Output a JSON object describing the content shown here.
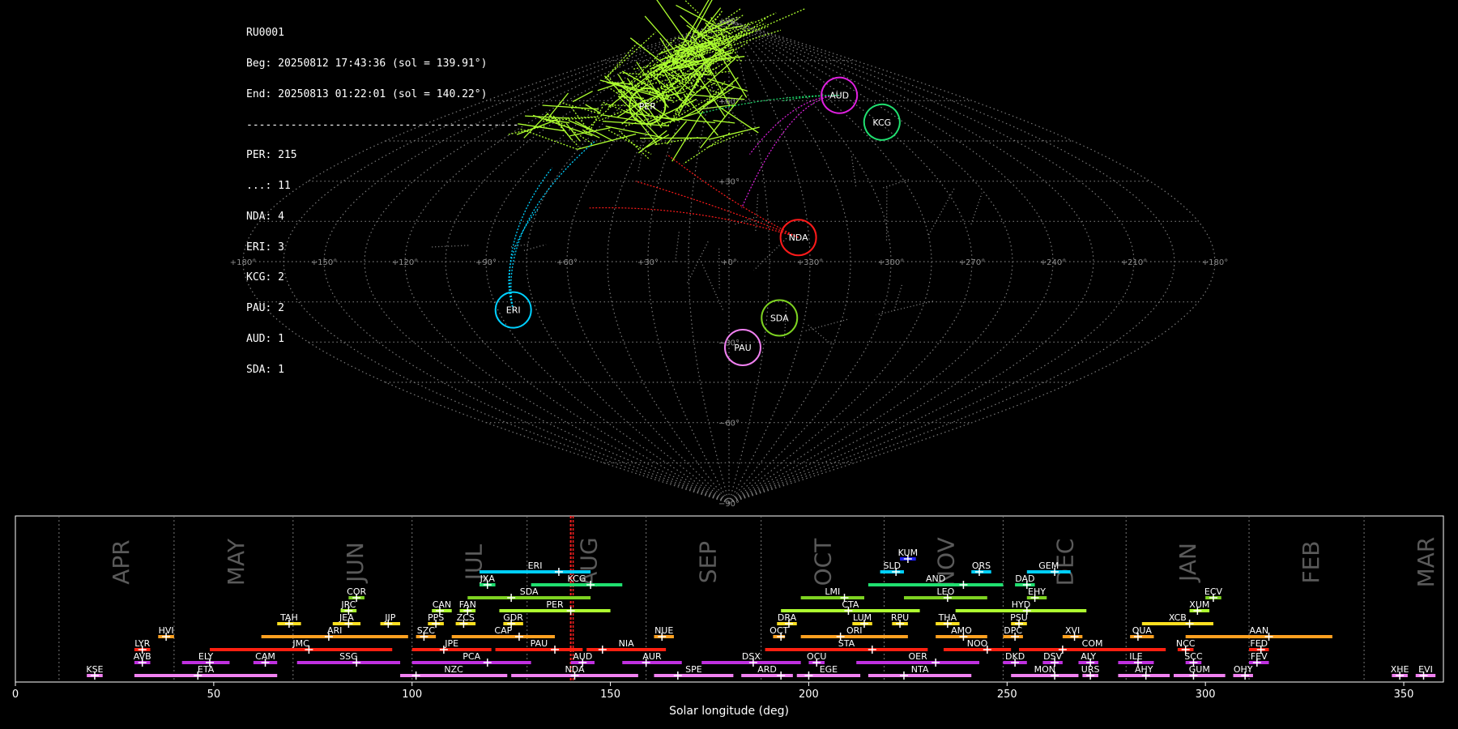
{
  "info": {
    "station": "RU0001",
    "beg": "Beg: 20250812 17:43:36 (sol = 139.91°)",
    "end": "End: 20250813 01:22:01 (sol = 140.22°)",
    "divider": "-------------------------------------------",
    "counts": [
      "PER: 215",
      "...: 11",
      "NDA: 4",
      "ERI: 3",
      "KCG: 2",
      "PAU: 2",
      "AUD: 1",
      "SDA: 1"
    ]
  },
  "colors": {
    "background": "#000000",
    "grid": "#7a7a7a",
    "PER": "#adff2f",
    "ERI": "#00d0ff",
    "NDA": "#ff1a1a",
    "KCG": "#20e070",
    "AUD": "#e020e0",
    "SDA": "#7ed321",
    "PAU": "#f080f0",
    "sporadic": "#8a8a8a"
  },
  "chart_data": [
    {
      "type": "scatter",
      "projection": "sinusoidal",
      "lon_labels": [
        "+180°",
        "+150°",
        "+120°",
        "+90°",
        "+60°",
        "+30°",
        "+0°",
        "+330°",
        "+300°",
        "+270°",
        "+240°",
        "+210°",
        "+180°"
      ],
      "lon_values": [
        180,
        150,
        120,
        90,
        60,
        30,
        0,
        330,
        300,
        270,
        240,
        210,
        180
      ],
      "lat_labels": [
        "+90°",
        "+60°",
        "+30°",
        "+0°",
        "−30°",
        "−60°",
        "−90°"
      ],
      "lat_values": [
        90,
        60,
        30,
        0,
        -30,
        -60,
        -90
      ],
      "grid": true,
      "radiants": [
        {
          "name": "PER",
          "lon": 57,
          "lat": 58,
          "circle_r": 4
        },
        {
          "name": "AUD",
          "lon": -87,
          "lat": 62,
          "circle_r": 4.5
        },
        {
          "name": "KCG",
          "lon": -92,
          "lat": 52,
          "circle_r": 4.5
        },
        {
          "name": "NDA",
          "lon": -26,
          "lat": 9,
          "circle_r": 3
        },
        {
          "name": "SDA",
          "lon": -20,
          "lat": -21,
          "circle_r": 3
        },
        {
          "name": "PAU",
          "lon": -6,
          "lat": -32,
          "circle_r": 3
        },
        {
          "name": "ERI",
          "lon": 84,
          "lat": -18,
          "circle_r": 3
        }
      ]
    },
    {
      "type": "bar",
      "orientation": "horizontal-ranges",
      "xlabel": "Solar longitude (deg)",
      "xlim": [
        0,
        360
      ],
      "xticks": [
        0,
        50,
        100,
        150,
        200,
        250,
        300,
        350
      ],
      "current_sol": 140,
      "months": [
        {
          "label": "APR",
          "start": 11
        },
        {
          "label": "MAY",
          "start": 40
        },
        {
          "label": "JUN",
          "start": 70
        },
        {
          "label": "JUL",
          "start": 100
        },
        {
          "label": "AUG",
          "start": 129
        },
        {
          "label": "SEP",
          "start": 159
        },
        {
          "label": "OCT",
          "start": 188
        },
        {
          "label": "NOV",
          "start": 219
        },
        {
          "label": "DEC",
          "start": 249
        },
        {
          "label": "JAN",
          "start": 280
        },
        {
          "label": "FEB",
          "start": 311
        },
        {
          "label": "MAR",
          "start": 340
        }
      ],
      "showers": [
        {
          "name": "KUM",
          "start": 223,
          "end": 227,
          "peak": 225,
          "row": 9,
          "color": "#2020ff"
        },
        {
          "name": "ERI",
          "start": 117,
          "end": 145,
          "peak": 137,
          "row": 8,
          "color": "#00d0ff"
        },
        {
          "name": "SLD",
          "start": 218,
          "end": 224,
          "peak": 222,
          "row": 8,
          "color": "#00d0ff"
        },
        {
          "name": "ORS",
          "start": 241,
          "end": 246,
          "peak": 243,
          "row": 8,
          "color": "#00d0ff"
        },
        {
          "name": "GEM",
          "start": 255,
          "end": 266,
          "peak": 262,
          "row": 8,
          "color": "#00d0ff"
        },
        {
          "name": "JXA",
          "start": 117,
          "end": 121,
          "peak": 119,
          "row": 7,
          "color": "#20e070"
        },
        {
          "name": "KCG",
          "start": 130,
          "end": 153,
          "peak": 145,
          "row": 7,
          "color": "#20e070"
        },
        {
          "name": "AND",
          "start": 215,
          "end": 249,
          "peak": 239,
          "row": 7,
          "color": "#20e070"
        },
        {
          "name": "DAD",
          "start": 252,
          "end": 257,
          "peak": 255,
          "row": 7,
          "color": "#20e070"
        },
        {
          "name": "COR",
          "start": 84,
          "end": 88,
          "peak": 86,
          "row": 6,
          "color": "#7ed321"
        },
        {
          "name": "SDA",
          "start": 114,
          "end": 145,
          "peak": 125,
          "row": 6,
          "color": "#7ed321"
        },
        {
          "name": "LMI",
          "start": 198,
          "end": 214,
          "peak": 209,
          "row": 6,
          "color": "#7ed321"
        },
        {
          "name": "LEO",
          "start": 224,
          "end": 245,
          "peak": 235,
          "row": 6,
          "color": "#7ed321"
        },
        {
          "name": "EHY",
          "start": 255,
          "end": 260,
          "peak": 257,
          "row": 6,
          "color": "#7ed321"
        },
        {
          "name": "ECV",
          "start": 300,
          "end": 304,
          "peak": 302,
          "row": 6,
          "color": "#7ed321"
        },
        {
          "name": "JRC",
          "start": 82,
          "end": 86,
          "peak": 84,
          "row": 5,
          "color": "#adff2f"
        },
        {
          "name": "CAN",
          "start": 105,
          "end": 110,
          "peak": 107,
          "row": 5,
          "color": "#adff2f"
        },
        {
          "name": "FAN",
          "start": 112,
          "end": 116,
          "peak": 114,
          "row": 5,
          "color": "#adff2f"
        },
        {
          "name": "PER",
          "start": 122,
          "end": 150,
          "peak": 140,
          "row": 5,
          "color": "#adff2f"
        },
        {
          "name": "CTA",
          "start": 193,
          "end": 228,
          "peak": 210,
          "row": 5,
          "color": "#adff2f"
        },
        {
          "name": "HYD",
          "start": 237,
          "end": 270,
          "peak": 255,
          "row": 5,
          "color": "#adff2f"
        },
        {
          "name": "XUM",
          "start": 296,
          "end": 301,
          "peak": 298,
          "row": 5,
          "color": "#adff2f"
        },
        {
          "name": "TAH",
          "start": 66,
          "end": 72,
          "peak": 69,
          "row": 4,
          "color": "#ffe020"
        },
        {
          "name": "JEA",
          "start": 80,
          "end": 87,
          "peak": 84,
          "row": 4,
          "color": "#ffe020"
        },
        {
          "name": "JIP",
          "start": 92,
          "end": 97,
          "peak": 94,
          "row": 4,
          "color": "#ffe020"
        },
        {
          "name": "PPS",
          "start": 104,
          "end": 108,
          "peak": 106,
          "row": 4,
          "color": "#ffe020"
        },
        {
          "name": "ZCS",
          "start": 111,
          "end": 116,
          "peak": 113,
          "row": 4,
          "color": "#ffe020"
        },
        {
          "name": "GDR",
          "start": 123,
          "end": 128,
          "peak": 125,
          "row": 4,
          "color": "#ffe020"
        },
        {
          "name": "DRA",
          "start": 192,
          "end": 197,
          "peak": 195,
          "row": 4,
          "color": "#ffe020"
        },
        {
          "name": "LUM",
          "start": 211,
          "end": 216,
          "peak": 214,
          "row": 4,
          "color": "#ffe020"
        },
        {
          "name": "RPU",
          "start": 221,
          "end": 225,
          "peak": 223,
          "row": 4,
          "color": "#ffe020"
        },
        {
          "name": "THA",
          "start": 232,
          "end": 238,
          "peak": 235,
          "row": 4,
          "color": "#ffe020"
        },
        {
          "name": "PSU",
          "start": 251,
          "end": 255,
          "peak": 253,
          "row": 4,
          "color": "#ffe020"
        },
        {
          "name": "XCB",
          "start": 284,
          "end": 302,
          "peak": 296,
          "row": 4,
          "color": "#ffe020"
        },
        {
          "name": "HVI",
          "start": 36,
          "end": 40,
          "peak": 38,
          "row": 3,
          "color": "#ffa020"
        },
        {
          "name": "ARI",
          "start": 62,
          "end": 99,
          "peak": 79,
          "row": 3,
          "color": "#ffa020"
        },
        {
          "name": "SZC",
          "start": 101,
          "end": 106,
          "peak": 103,
          "row": 3,
          "color": "#ffa020"
        },
        {
          "name": "CAP",
          "start": 110,
          "end": 136,
          "peak": 127,
          "row": 3,
          "color": "#ffa020"
        },
        {
          "name": "NUE",
          "start": 161,
          "end": 166,
          "peak": 163,
          "row": 3,
          "color": "#ffa020"
        },
        {
          "name": "OCT",
          "start": 191,
          "end": 194,
          "peak": 193,
          "row": 3,
          "color": "#ffa020"
        },
        {
          "name": "ORI",
          "start": 198,
          "end": 225,
          "peak": 208,
          "row": 3,
          "color": "#ffa020"
        },
        {
          "name": "AMO",
          "start": 232,
          "end": 245,
          "peak": 239,
          "row": 3,
          "color": "#ffa020"
        },
        {
          "name": "DPC",
          "start": 249,
          "end": 254,
          "peak": 252,
          "row": 3,
          "color": "#ffa020"
        },
        {
          "name": "XVI",
          "start": 264,
          "end": 269,
          "peak": 267,
          "row": 3,
          "color": "#ffa020"
        },
        {
          "name": "QUA",
          "start": 281,
          "end": 287,
          "peak": 283,
          "row": 3,
          "color": "#ffa020"
        },
        {
          "name": "AAN",
          "start": 295,
          "end": 332,
          "peak": 316,
          "row": 3,
          "color": "#ffa020"
        },
        {
          "name": "LYR",
          "start": 30,
          "end": 34,
          "peak": 32,
          "row": 2,
          "color": "#ff2010"
        },
        {
          "name": "JMC",
          "start": 49,
          "end": 95,
          "peak": 74,
          "row": 2,
          "color": "#ff2010"
        },
        {
          "name": "JPE",
          "start": 100,
          "end": 120,
          "peak": 108,
          "row": 2,
          "color": "#ff2010"
        },
        {
          "name": "PAU",
          "start": 121,
          "end": 143,
          "peak": 136,
          "row": 2,
          "color": "#ff2010"
        },
        {
          "name": "NIA",
          "start": 144,
          "end": 164,
          "peak": 148,
          "row": 2,
          "color": "#ff2010"
        },
        {
          "name": "STA",
          "start": 189,
          "end": 230,
          "peak": 216,
          "row": 2,
          "color": "#ff2010"
        },
        {
          "name": "NOO",
          "start": 234,
          "end": 251,
          "peak": 245,
          "row": 2,
          "color": "#ff2010"
        },
        {
          "name": "COM",
          "start": 253,
          "end": 290,
          "peak": 264,
          "row": 2,
          "color": "#ff2010"
        },
        {
          "name": "NCC",
          "start": 293,
          "end": 297,
          "peak": 295,
          "row": 2,
          "color": "#ff2010"
        },
        {
          "name": "FED",
          "start": 311,
          "end": 316,
          "peak": 314,
          "row": 2,
          "color": "#ff2010"
        },
        {
          "name": "AVB",
          "start": 30,
          "end": 34,
          "peak": 32,
          "row": 1,
          "color": "#c030e0"
        },
        {
          "name": "ELY",
          "start": 42,
          "end": 54,
          "peak": 49,
          "row": 1,
          "color": "#c030e0"
        },
        {
          "name": "CAM",
          "start": 60,
          "end": 66,
          "peak": 63,
          "row": 1,
          "color": "#c030e0"
        },
        {
          "name": "SSG",
          "start": 71,
          "end": 97,
          "peak": 86,
          "row": 1,
          "color": "#c030e0"
        },
        {
          "name": "PCA",
          "start": 100,
          "end": 130,
          "peak": 119,
          "row": 1,
          "color": "#c030e0"
        },
        {
          "name": "AUD",
          "start": 140,
          "end": 146,
          "peak": 143,
          "row": 1,
          "color": "#c030e0"
        },
        {
          "name": "AUR",
          "start": 153,
          "end": 168,
          "peak": 159,
          "row": 1,
          "color": "#c030e0"
        },
        {
          "name": "DSX",
          "start": 173,
          "end": 198,
          "peak": 186,
          "row": 1,
          "color": "#c030e0"
        },
        {
          "name": "OCU",
          "start": 200,
          "end": 204,
          "peak": 202,
          "row": 1,
          "color": "#c030e0"
        },
        {
          "name": "OER",
          "start": 212,
          "end": 243,
          "peak": 232,
          "row": 1,
          "color": "#c030e0"
        },
        {
          "name": "DKD",
          "start": 249,
          "end": 255,
          "peak": 252,
          "row": 1,
          "color": "#c030e0"
        },
        {
          "name": "DSV",
          "start": 259,
          "end": 264,
          "peak": 262,
          "row": 1,
          "color": "#c030e0"
        },
        {
          "name": "ALY",
          "start": 268,
          "end": 273,
          "peak": 271,
          "row": 1,
          "color": "#c030e0"
        },
        {
          "name": "ILE",
          "start": 278,
          "end": 287,
          "peak": 283,
          "row": 1,
          "color": "#c030e0"
        },
        {
          "name": "SCC",
          "start": 295,
          "end": 299,
          "peak": 297,
          "row": 1,
          "color": "#c030e0"
        },
        {
          "name": "FEV",
          "start": 311,
          "end": 316,
          "peak": 313,
          "row": 1,
          "color": "#c030e0"
        },
        {
          "name": "KSE",
          "start": 18,
          "end": 22,
          "peak": 20,
          "row": 0,
          "color": "#f080f0"
        },
        {
          "name": "ETA",
          "start": 30,
          "end": 66,
          "peak": 46,
          "row": 0,
          "color": "#f080f0"
        },
        {
          "name": "NZC",
          "start": 97,
          "end": 124,
          "peak": 101,
          "row": 0,
          "color": "#f080f0"
        },
        {
          "name": "NDA",
          "start": 125,
          "end": 157,
          "peak": 141,
          "row": 0,
          "color": "#f080f0"
        },
        {
          "name": "SPE",
          "start": 161,
          "end": 181,
          "peak": 167,
          "row": 0,
          "color": "#f080f0"
        },
        {
          "name": "ARD",
          "start": 183,
          "end": 196,
          "peak": 193,
          "row": 0,
          "color": "#f080f0"
        },
        {
          "name": "EGE",
          "start": 197,
          "end": 213,
          "peak": 200,
          "row": 0,
          "color": "#f080f0"
        },
        {
          "name": "NTA",
          "start": 215,
          "end": 241,
          "peak": 224,
          "row": 0,
          "color": "#f080f0"
        },
        {
          "name": "MON",
          "start": 251,
          "end": 268,
          "peak": 262,
          "row": 0,
          "color": "#f080f0"
        },
        {
          "name": "URS",
          "start": 269,
          "end": 273,
          "peak": 271,
          "row": 0,
          "color": "#f080f0"
        },
        {
          "name": "AHY",
          "start": 278,
          "end": 291,
          "peak": 285,
          "row": 0,
          "color": "#f080f0"
        },
        {
          "name": "GUM",
          "start": 292,
          "end": 305,
          "peak": 297,
          "row": 0,
          "color": "#f080f0"
        },
        {
          "name": "OHY",
          "start": 307,
          "end": 312,
          "peak": 310,
          "row": 0,
          "color": "#f080f0"
        },
        {
          "name": "XHE",
          "start": 347,
          "end": 351,
          "peak": 349,
          "row": 0,
          "color": "#f080f0"
        },
        {
          "name": "EVI",
          "start": 353,
          "end": 358,
          "peak": 355,
          "row": 0,
          "color": "#f080f0"
        }
      ]
    }
  ]
}
